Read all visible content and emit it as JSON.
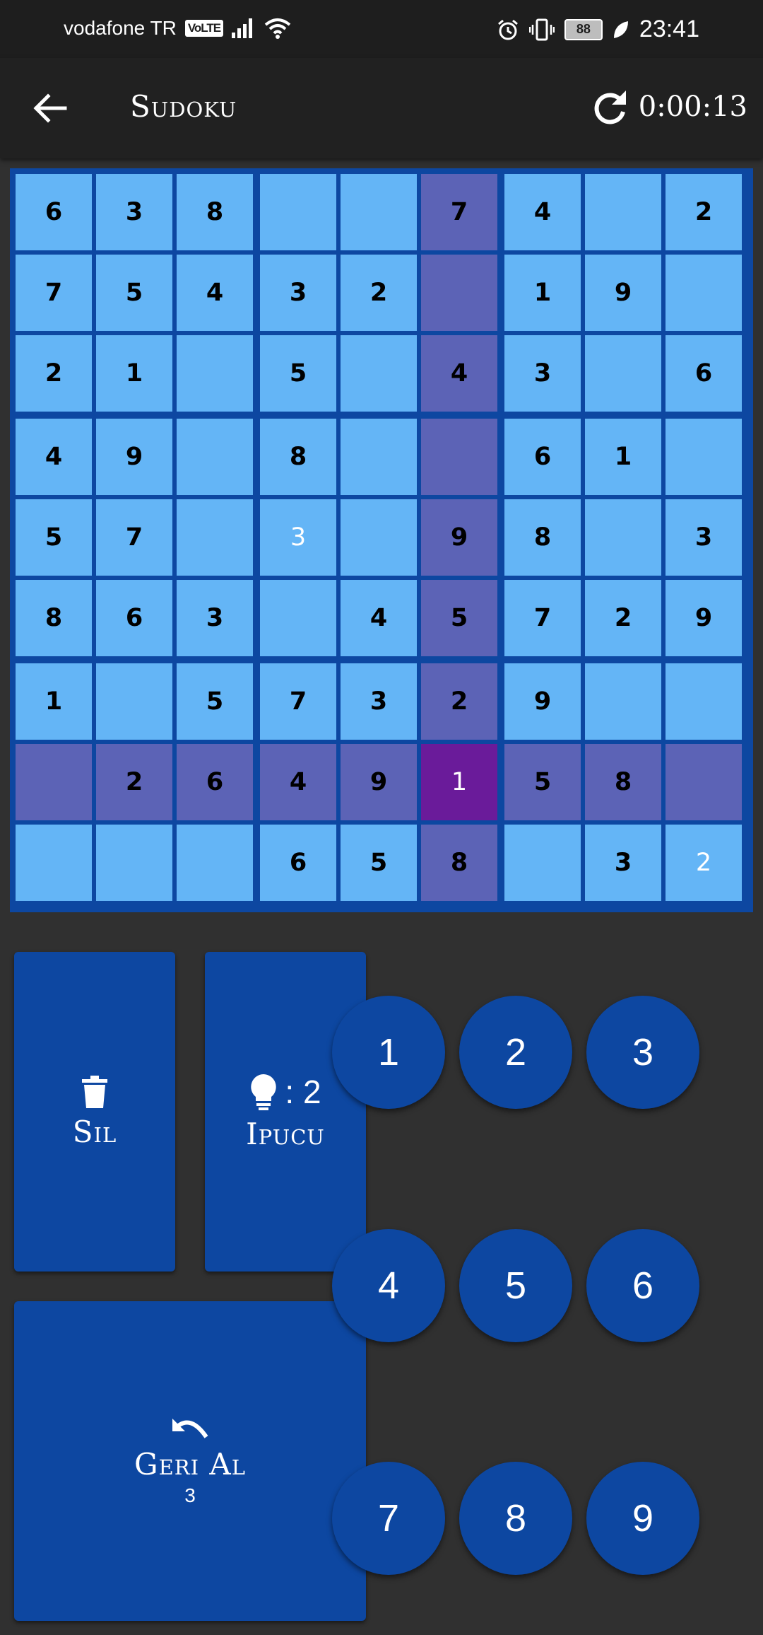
{
  "status_bar": {
    "carrier": "vodafone TR",
    "volte": "VoLTE",
    "battery": "88",
    "time": "23:41"
  },
  "app_bar": {
    "title": "Sudoku",
    "timer": "0:00:13"
  },
  "board": {
    "cells": [
      [
        "6",
        "3",
        "8",
        "",
        "",
        "7",
        "4",
        "",
        "2"
      ],
      [
        "7",
        "5",
        "4",
        "3",
        "2",
        "",
        "1",
        "9",
        ""
      ],
      [
        "2",
        "1",
        "",
        "5",
        "",
        "4",
        "3",
        "",
        "6"
      ],
      [
        "4",
        "9",
        "",
        "8",
        "",
        "",
        "6",
        "1",
        ""
      ],
      [
        "5",
        "7",
        "",
        "3",
        "",
        "9",
        "8",
        "",
        "3"
      ],
      [
        "8",
        "6",
        "3",
        "",
        "4",
        "5",
        "7",
        "2",
        "9"
      ],
      [
        "1",
        "",
        "5",
        "7",
        "3",
        "2",
        "9",
        "",
        ""
      ],
      [
        "",
        "2",
        "6",
        "4",
        "9",
        "1",
        "5",
        "8",
        ""
      ],
      [
        "",
        "",
        "",
        "6",
        "5",
        "8",
        "",
        "3",
        "2"
      ]
    ],
    "user_entries": [
      [
        4,
        3
      ],
      [
        8,
        8
      ]
    ],
    "selected": [
      7,
      5
    ],
    "highlight_row": 7,
    "highlight_col": 5
  },
  "actions": {
    "delete_label": "Sil",
    "hint_label": "Ipucu",
    "hint_count": ": 2",
    "undo_label": "Geri Al",
    "undo_count": "3"
  },
  "numpad": [
    "1",
    "2",
    "3",
    "4",
    "5",
    "6",
    "7",
    "8",
    "9"
  ],
  "colors": {
    "cell": "#64b5f6",
    "highlight": "#5c63b6",
    "selected": "#6a1b9a",
    "board_border": "#0d47a1",
    "button": "#0d47a1"
  }
}
